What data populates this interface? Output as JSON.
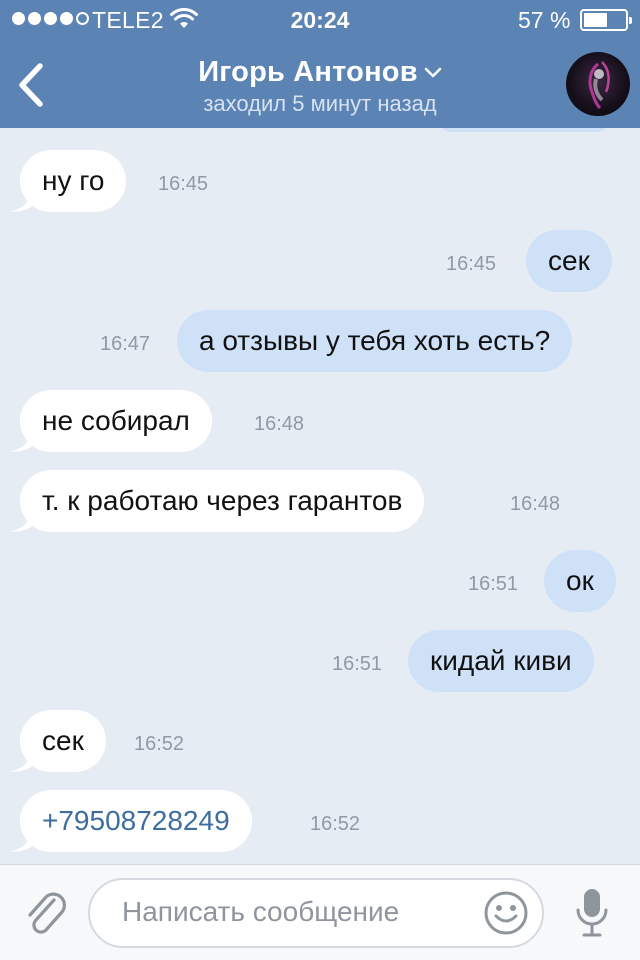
{
  "status_bar": {
    "carrier": "TELE2",
    "time": "20:24",
    "battery_percent_text": "57 %",
    "battery_level": 0.57,
    "signal_bars_filled": 4,
    "signal_bars_total": 5
  },
  "header": {
    "contact_name": "Игорь Антонов",
    "status": "заходил 5 минут назад"
  },
  "messages": [
    {
      "direction": "in",
      "text": "ну го",
      "time": "16:45"
    },
    {
      "direction": "out",
      "text": "сек",
      "time": "16:45"
    },
    {
      "direction": "out",
      "text": "а отзывы у тебя хоть есть?",
      "time": "16:47"
    },
    {
      "direction": "in",
      "text": "не собирал",
      "time": "16:48"
    },
    {
      "direction": "in",
      "text": "т. к работаю через гарантов",
      "time": "16:48"
    },
    {
      "direction": "out",
      "text": "ок",
      "time": "16:51"
    },
    {
      "direction": "out",
      "text": "кидай киви",
      "time": "16:51"
    },
    {
      "direction": "in",
      "text": "сек",
      "time": "16:52"
    },
    {
      "direction": "in",
      "text": "+79508728249",
      "time": "16:52"
    }
  ],
  "composer": {
    "placeholder": "Написать сообщение"
  },
  "icons": {
    "back": "chevron-left-icon",
    "attach": "paperclip-icon",
    "emoji": "smiley-icon",
    "mic": "microphone-icon"
  },
  "colors": {
    "header_bg": "#5b83b4",
    "chat_bg": "#e6ecf4",
    "incoming_bubble": "#ffffff",
    "outgoing_bubble": "#cfe1f7",
    "link": "#3e6e9f"
  }
}
